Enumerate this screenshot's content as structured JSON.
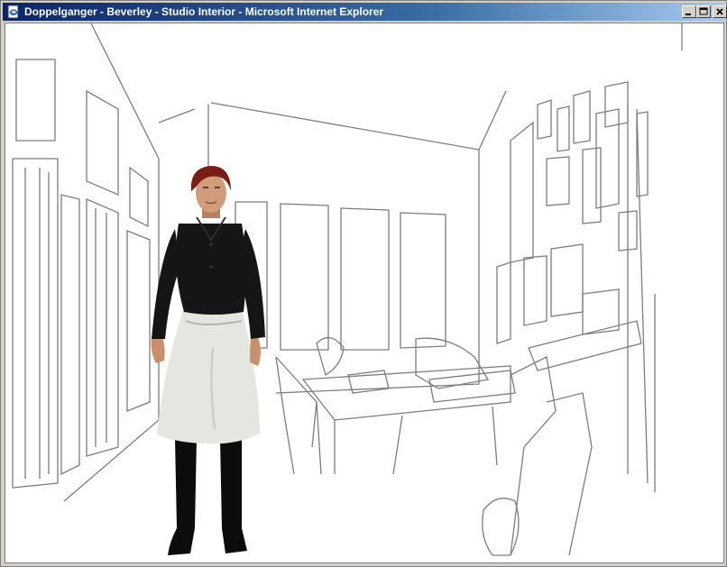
{
  "window": {
    "title": "Doppelganger - Beverley - Studio Interior - Microsoft Internet Explorer",
    "icon": "ie-page-icon",
    "controls": [
      "minimize-icon",
      "maximize-icon",
      "close-icon"
    ]
  },
  "scene": {
    "background": "pencil-sketch-studio-interior",
    "avatar": "3d-woman-avatar",
    "colors": {
      "hair": "#7a1d14",
      "top": "#151515",
      "skirt": "#e6e6e0",
      "boots": "#0c0c0c",
      "sketch_line": "#7d7d7d"
    }
  }
}
